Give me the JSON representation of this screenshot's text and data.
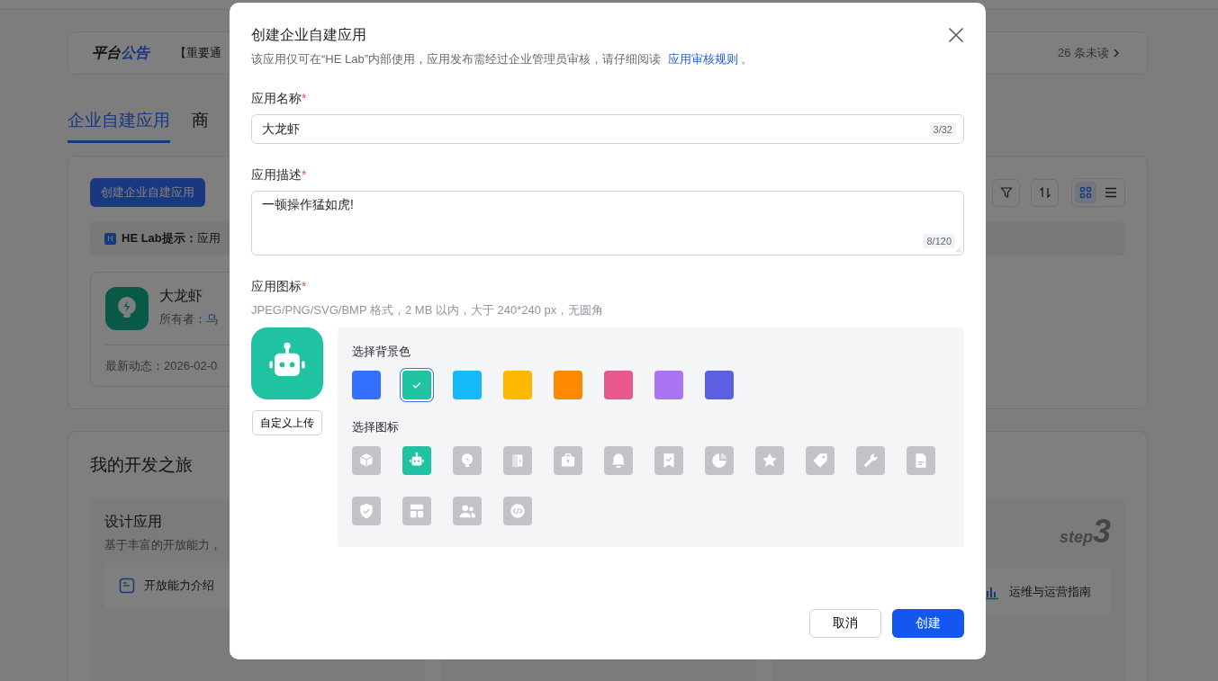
{
  "background": {
    "announcement": {
      "title_plain": "平台",
      "title_accent": "公告",
      "notice": "【重要通",
      "unread": "26 条未读"
    },
    "tabs": [
      {
        "label": "企业自建应用",
        "selected": true
      },
      {
        "label": "商",
        "selected": false
      }
    ],
    "create_button": "创建企业自建应用",
    "view_modes": [
      {
        "kind": "grid",
        "selected": true
      },
      {
        "kind": "list",
        "selected": false
      }
    ],
    "hint": {
      "badge": "H",
      "text": "**HE Lab提示：**应用"
    },
    "app_card": {
      "name": "大龙虾",
      "owner_label": "所有者：",
      "owner": "乌",
      "latest": "最新动态：2026-02-0"
    },
    "journey": {
      "title": "我的开发之旅",
      "step_title": "设计应用",
      "step_desc": "基于丰富的开放能力，",
      "step_link": "开放能力介绍",
      "step3_word": "step",
      "step3_number": "3",
      "step3_link": "运维与运营指南"
    }
  },
  "dialog": {
    "title": "创建企业自建应用",
    "subtitle": "该应用仅可在“HE Lab”内部使用，应用发布需经过企业管理员审核，请仔细阅读",
    "rules_link": "应用审核规则",
    "subtitle_end": "。",
    "required_mark": "*",
    "name_label": "应用名称",
    "name_value": "大龙虾",
    "name_count": "3/32",
    "desc_label": "应用描述",
    "desc_value": "一顿操作猛如虎!",
    "desc_count": "8/120",
    "icon_label": "应用图标",
    "icon_hint": "JPEG/PNG/SVG/BMP 格式，2 MB 以内，大于 240*240 px，无圆角",
    "upload_button": "自定义上传",
    "color_label": "选择背景色",
    "colors": [
      {
        "color": "#3370ff",
        "selected": false
      },
      {
        "color": "#1fc3a2",
        "selected": true
      },
      {
        "color": "#14b9f7",
        "selected": false
      },
      {
        "color": "#ffb800",
        "selected": false
      },
      {
        "color": "#ff8a00",
        "selected": false
      },
      {
        "color": "#e8588f",
        "selected": false
      },
      {
        "color": "#a973f2",
        "selected": false
      },
      {
        "color": "#5b5fe2",
        "selected": false
      }
    ],
    "icon_choice_label": "选择图标",
    "icons": [
      {
        "kind": "cube",
        "selected": false
      },
      {
        "kind": "robot",
        "selected": true
      },
      {
        "kind": "lightbulb",
        "selected": false
      },
      {
        "kind": "door",
        "selected": false
      },
      {
        "kind": "briefcase",
        "selected": false
      },
      {
        "kind": "bell",
        "selected": false
      },
      {
        "kind": "bookmark",
        "selected": false
      },
      {
        "kind": "pie",
        "selected": false
      },
      {
        "kind": "star",
        "selected": false
      },
      {
        "kind": "tag",
        "selected": false
      },
      {
        "kind": "wrench",
        "selected": false
      },
      {
        "kind": "document",
        "selected": false
      },
      {
        "kind": "shield",
        "selected": false
      },
      {
        "kind": "layout",
        "selected": false
      },
      {
        "kind": "people",
        "selected": false
      },
      {
        "kind": "code",
        "selected": false
      }
    ],
    "cancel_button": "取消",
    "create_button": "创建"
  }
}
